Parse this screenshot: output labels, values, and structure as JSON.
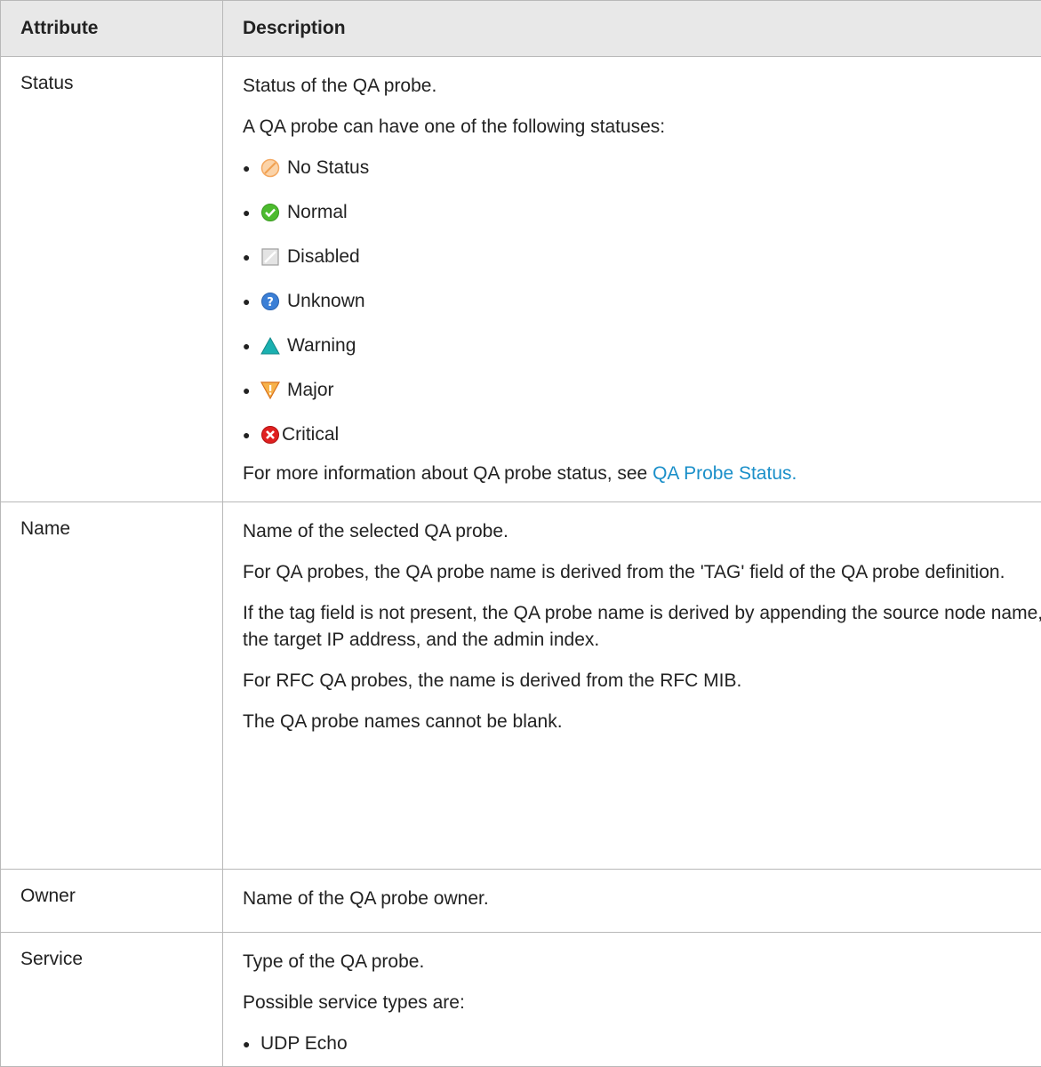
{
  "header": {
    "attribute": "Attribute",
    "description": "Description"
  },
  "rows": {
    "status": {
      "name": "Status",
      "intro": "Status of the QA probe.",
      "list_intro": "A QA probe can have one of the following statuses:",
      "statuses": [
        {
          "label": "No Status",
          "icon": "no-status-icon",
          "color": "#f4a860"
        },
        {
          "label": "Normal",
          "icon": "normal-icon",
          "color": "#4cbb2e"
        },
        {
          "label": "Disabled",
          "icon": "disabled-icon",
          "color": "#bdbdbd"
        },
        {
          "label": "Unknown",
          "icon": "unknown-icon",
          "color": "#3b7fd6"
        },
        {
          "label": "Warning",
          "icon": "warning-icon",
          "color": "#1ab0b0"
        },
        {
          "label": "Major",
          "icon": "major-icon",
          "color": "#f08a2a"
        },
        {
          "label": "Critical",
          "icon": "critical-icon",
          "color": "#e02020"
        }
      ],
      "more_info_prefix": "For more information about QA probe status, see ",
      "more_info_link": "QA Probe Status."
    },
    "name": {
      "name": "Name",
      "p1": "Name of the selected QA probe.",
      "p2": "For QA probes, the QA probe name is derived from the 'TAG' field of the QA probe definition.",
      "p3": "If the tag field is not present, the QA probe name is derived by appending the source node name, the target IP address, and the admin index.",
      "p4": "For RFC QA probes, the name is derived from the RFC MIB.",
      "p5": "The QA probe names cannot be blank."
    },
    "owner": {
      "name": "Owner",
      "p1": "Name of the QA probe owner."
    },
    "service": {
      "name": "Service",
      "p1": "Type of the QA probe.",
      "p2": "Possible service types are:",
      "types": [
        "UDP Echo"
      ]
    }
  },
  "colors": {
    "link": "#1a8fc9",
    "header_bg": "#e8e8e8",
    "border": "#b8b8b8"
  }
}
